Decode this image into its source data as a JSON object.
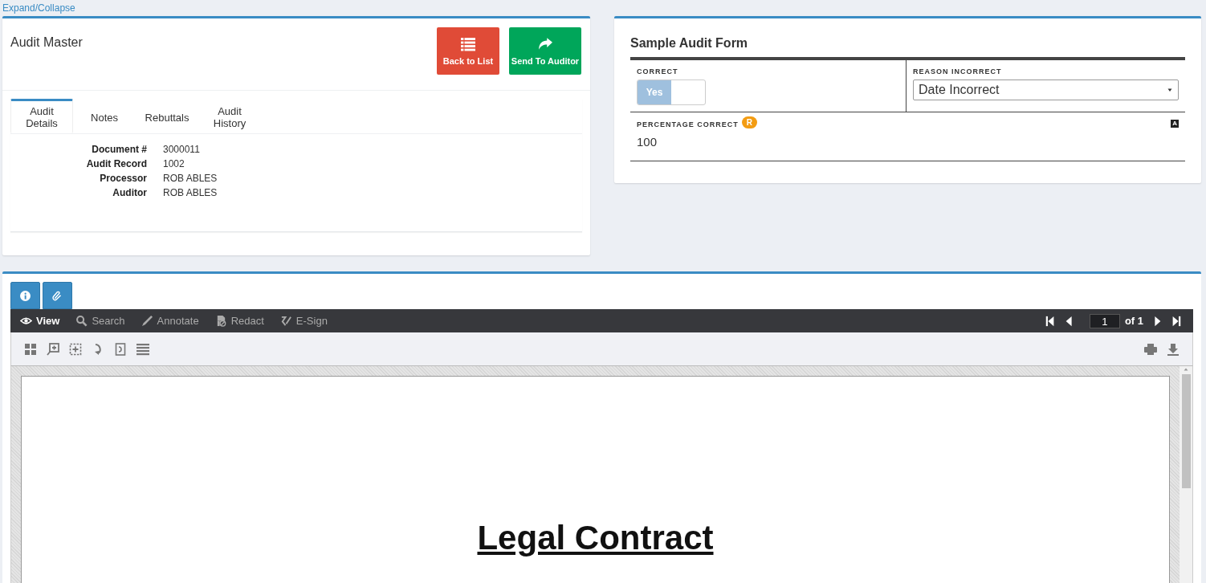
{
  "expand_link": "Expand/Collapse",
  "audit_master": {
    "title": "Audit Master",
    "buttons": [
      {
        "kind": "list",
        "label": "Back to List"
      },
      {
        "kind": "send",
        "label": "Send To Auditor"
      }
    ],
    "tabs": [
      {
        "label": "Audit Details",
        "selected": true
      },
      {
        "label": "Notes",
        "selected": false
      },
      {
        "label": "Rebuttals",
        "selected": false
      },
      {
        "label": "Audit History",
        "selected": false
      }
    ],
    "details": [
      {
        "label": "Document #",
        "value": "3000011"
      },
      {
        "label": "Audit Record",
        "value": "1002"
      },
      {
        "label": "Processor",
        "value": "ROB ABLES"
      },
      {
        "label": "Auditor",
        "value": "ROB ABLES"
      }
    ]
  },
  "audit_form": {
    "title": "Sample Audit Form",
    "correct": {
      "label": "CORRECT",
      "option": "Yes",
      "on": true
    },
    "reason": {
      "label": "REASON INCORRECT",
      "value": "Date Incorrect"
    },
    "percentage": {
      "label": "PERCENTAGE CORRECT",
      "badge": "R",
      "marker": "A",
      "value": "100"
    }
  },
  "viewer": {
    "modes": [
      {
        "kind": "view",
        "label": "View",
        "selected": true
      },
      {
        "kind": "search",
        "label": "Search",
        "selected": false
      },
      {
        "kind": "annotate",
        "label": "Annotate",
        "selected": false
      },
      {
        "kind": "redact",
        "label": "Redact",
        "selected": false
      },
      {
        "kind": "esign",
        "label": "E-Sign",
        "selected": false
      }
    ],
    "page": "1",
    "page_count": "of 1",
    "document_title": "Legal Contract"
  }
}
